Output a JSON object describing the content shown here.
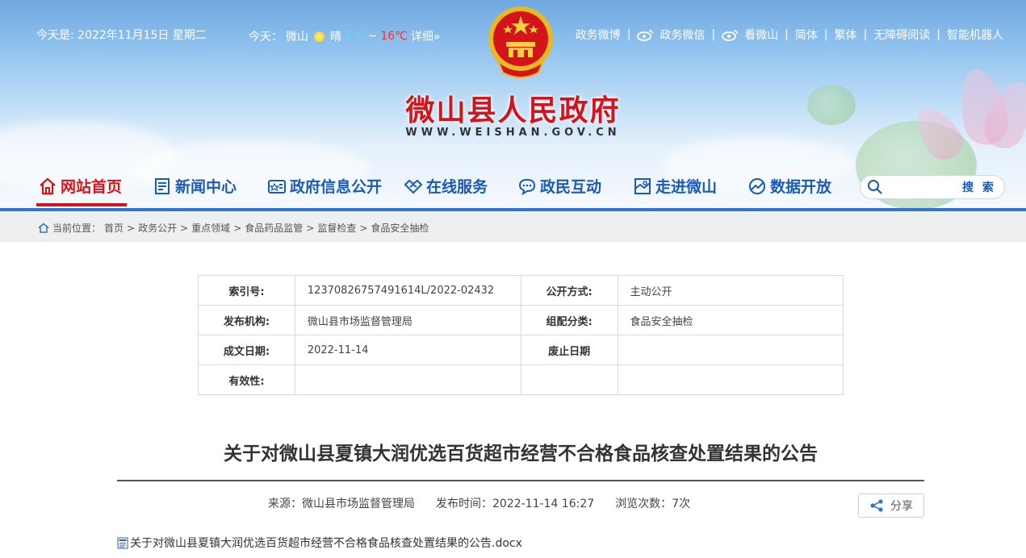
{
  "header": {
    "date_text": "今天是:  2022年11月15日 星期二",
    "weather": {
      "prefix": "今天：",
      "city": "微山",
      "condition": "晴",
      "low": "5℃",
      "tilde": "~",
      "high": "16℃",
      "detail": "详细»"
    },
    "top_links": [
      "政务微博",
      "政务微信",
      "看微山",
      "简体",
      "繁体",
      "无障碍阅读",
      "智能机器人"
    ],
    "site_title": "微山县人民政府",
    "site_domain": "WWW.WEISHAN.GOV.CN"
  },
  "nav": {
    "items": [
      "网站首页",
      "新闻中心",
      "政府信息公开",
      "在线服务",
      "政民互动",
      "走进微山",
      "数据开放"
    ],
    "search_button": "搜 索",
    "search_placeholder": ""
  },
  "breadcrumb": {
    "prefix": "当前位置：",
    "items": [
      "首页",
      "政务公开",
      "重点领域",
      "食品药品监管",
      "监督检查",
      "食品安全抽检"
    ],
    "separator": ">"
  },
  "meta": {
    "index_label": "索引号:",
    "index_value": "12370826757491614L/2022-02432",
    "open_label": "公开方式:",
    "open_value": "主动公开",
    "org_label": "发布机构:",
    "org_value": "微山县市场监督管理局",
    "category_label": "组配分类:",
    "category_value": "食品安全抽检",
    "date_label": "成文日期:",
    "date_value": "2022-11-14",
    "expire_label": "废止日期",
    "expire_value": "",
    "validity_label": "有效性:",
    "validity_value": ""
  },
  "article": {
    "title": "关于对微山县夏镇大润优选百货超市经营不合格食品核查处置结果的公告",
    "source": "来源：微山县市场监督管理局",
    "publish_time": "发布时间：2022-11-14 16:27",
    "views": "浏览次数：7次",
    "share_label": "分享",
    "attachment": "关于对微山县夏镇大润优选百货超市经营不合格食品核查处置结果的公告.docx"
  },
  "colors": {
    "brand_red": "#d4141b",
    "nav_blue": "#1a5bb5",
    "crumb_border": "#2f77cd"
  }
}
